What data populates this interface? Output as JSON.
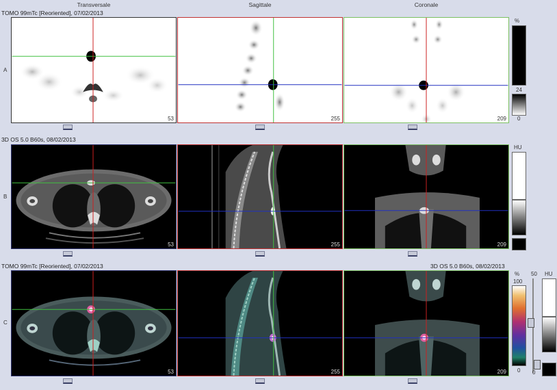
{
  "columns": {
    "transversale": "Transversale",
    "sagittale": "Sagittale",
    "coronale": "Coronale"
  },
  "rows": {
    "a": {
      "letter": "A",
      "title": "TOMO 99mTc [Reoriented], 07/02/2013"
    },
    "b": {
      "letter": "B",
      "title": "3D  OS  5.0  B60s, 08/02/2013"
    },
    "c": {
      "letter": "C",
      "title_left": "TOMO 99mTc [Reoriented], 07/02/2013",
      "title_right": "3D  OS  5.0  B60s, 08/02/2013"
    }
  },
  "slices": {
    "transversale": "53",
    "sagittale": "255",
    "coronale": "209"
  },
  "scale_a": {
    "unit": "%",
    "mid": "24",
    "low": "0"
  },
  "scale_b": {
    "unit": "HU"
  },
  "scale_c": {
    "unit_pct": "%",
    "max": "100",
    "min": "0",
    "mid": "50",
    "unit_hu": "HU",
    "low": "0"
  },
  "colors": {
    "crosshair_red": "#cc2020",
    "crosshair_green": "#40c040",
    "crosshair_blue": "#2030c0",
    "border_navy": "#2b2f6b",
    "border_red": "#c03030",
    "border_green": "#7bc060",
    "background": "#d8dcea"
  }
}
